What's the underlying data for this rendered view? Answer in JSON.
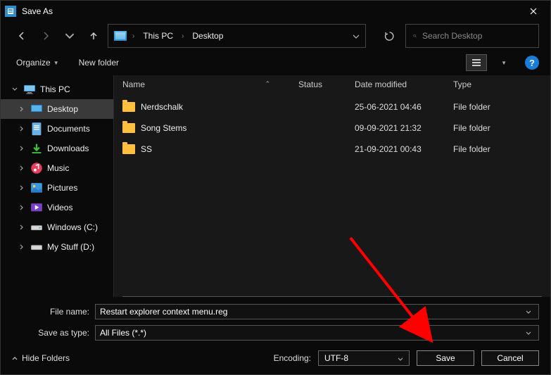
{
  "window": {
    "title": "Save As"
  },
  "breadcrumb": {
    "seg1": "This PC",
    "seg2": "Desktop"
  },
  "search": {
    "placeholder": "Search Desktop"
  },
  "toolbar": {
    "organize": "Organize",
    "newfolder": "New folder"
  },
  "help": {
    "glyph": "?"
  },
  "sidebar": {
    "thispc": "This PC",
    "desktop": "Desktop",
    "documents": "Documents",
    "downloads": "Downloads",
    "music": "Music",
    "pictures": "Pictures",
    "videos": "Videos",
    "cdrive": "Windows (C:)",
    "ddrive": "My Stuff (D:)"
  },
  "columns": {
    "name": "Name",
    "status": "Status",
    "date": "Date modified",
    "type": "Type"
  },
  "rows": [
    {
      "name": "Nerdschalk",
      "status": "",
      "date": "25-06-2021 04:46",
      "type": "File folder"
    },
    {
      "name": "Song Stems",
      "status": "",
      "date": "09-09-2021 21:32",
      "type": "File folder"
    },
    {
      "name": "SS",
      "status": "",
      "date": "21-09-2021 00:43",
      "type": "File folder"
    }
  ],
  "form": {
    "filename_label": "File name:",
    "filename_value": "Restart explorer context menu.reg",
    "type_label": "Save as type:",
    "type_value": "All Files  (*.*)",
    "encoding_label": "Encoding:",
    "encoding_value": "UTF-8",
    "hide_folders": "Hide Folders",
    "save": "Save",
    "cancel": "Cancel"
  }
}
